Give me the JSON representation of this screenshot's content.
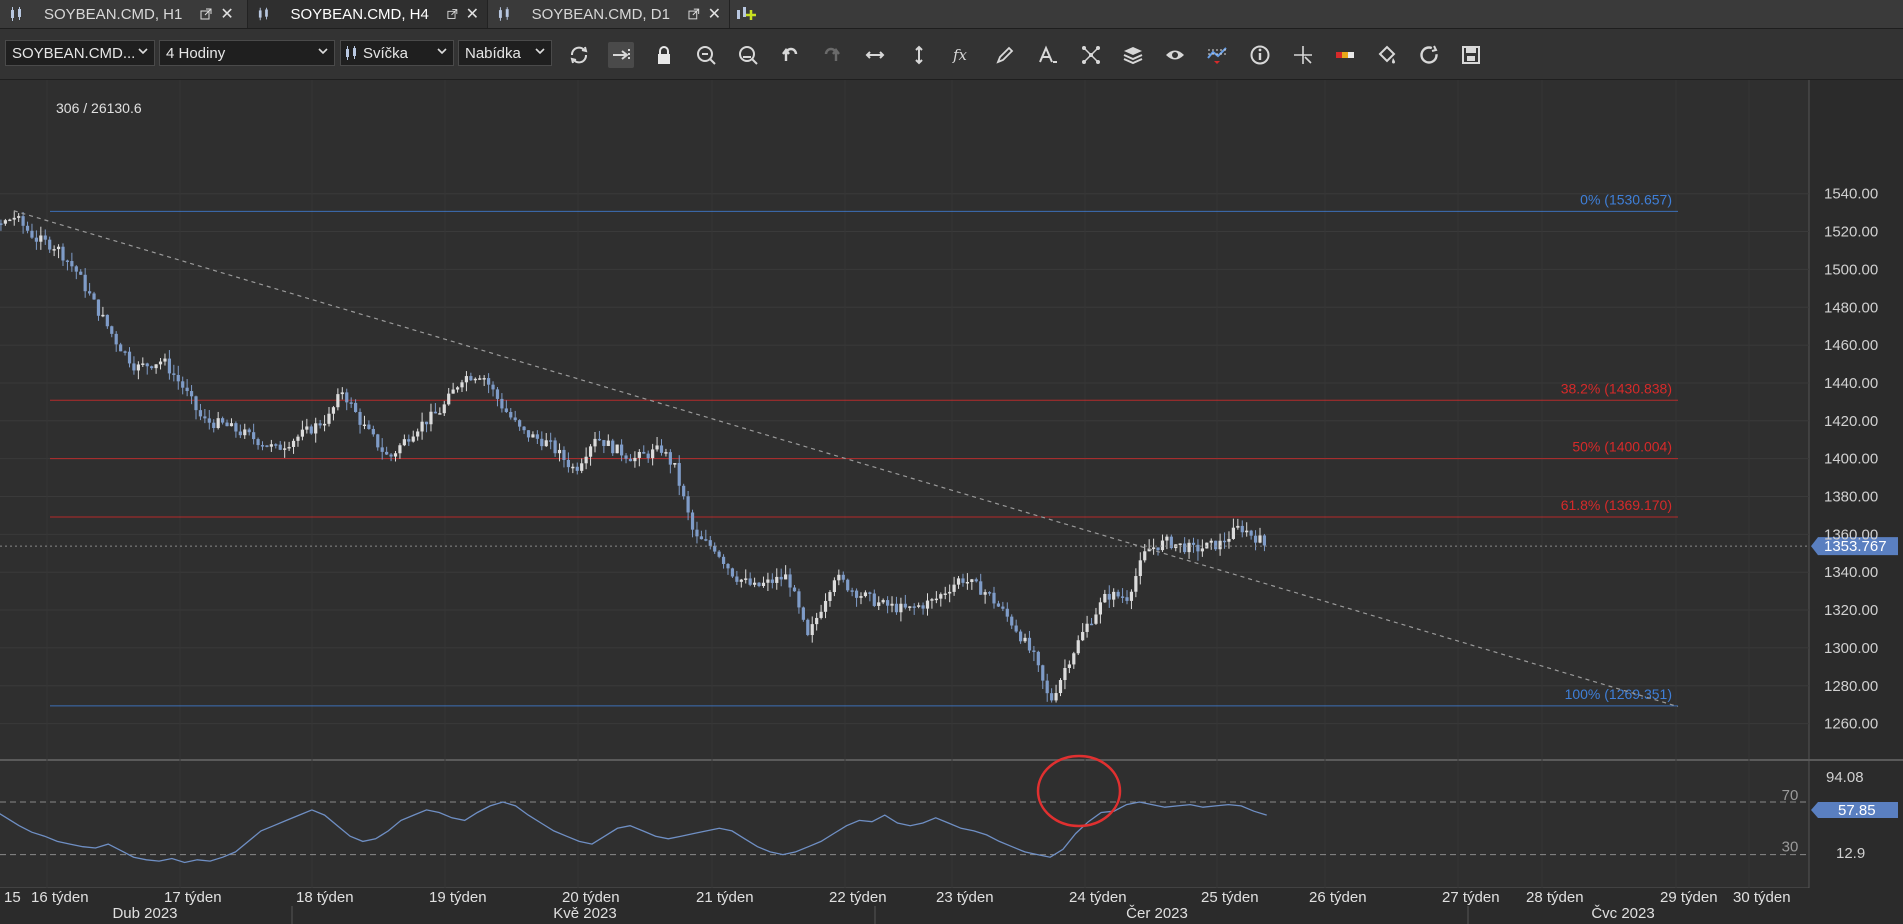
{
  "tabs": [
    {
      "label": "SOYBEAN.CMD, H1",
      "active": false
    },
    {
      "label": "SOYBEAN.CMD, H4",
      "active": true
    },
    {
      "label": "SOYBEAN.CMD, D1",
      "active": false
    }
  ],
  "toolbar": {
    "symbol": "SOYBEAN.CMD...",
    "timeframe": "4 Hodiny",
    "chart_type": "Svíčka",
    "price_type": "Nabídka"
  },
  "icons": [
    "refresh-icon",
    "autoscroll-icon",
    "lock-icon",
    "zoom-in-icon",
    "zoom-out-icon",
    "undo-icon",
    "redo-icon",
    "fit-horizontal-icon",
    "fit-vertical-icon",
    "indicators-icon",
    "draw-pencil-icon",
    "text-tool-icon",
    "objects-icon",
    "layers-icon",
    "visibility-icon",
    "compare-icon",
    "info-icon",
    "crosshair-icon",
    "color-scheme-icon",
    "paint-bucket-icon",
    "reload-icon",
    "save-icon"
  ],
  "chart_data": {
    "type": "candlestick",
    "symbol": "SOYBEAN.CMD",
    "timeframe": "H4",
    "crosshair_label": "306 / 26130.6",
    "price_axis": {
      "ticks": [
        1540,
        1520,
        1500,
        1480,
        1460,
        1440,
        1420,
        1400,
        1380,
        1360,
        1340,
        1320,
        1300,
        1280,
        1260
      ],
      "tick_labels": [
        "1540.00",
        "1520.00",
        "1500.00",
        "1480.00",
        "1460.00",
        "1440.00",
        "1420.00",
        "1400.00",
        "1380.00",
        "1360.00",
        "1340.00",
        "1320.00",
        "1300.00",
        "1280.00",
        "1260.00"
      ],
      "range": [
        1252,
        1548
      ]
    },
    "current_price": 1353.767,
    "current_price_label": "1353.767",
    "fibonacci": [
      {
        "label": "0% (1530.657)",
        "price": 1530.657,
        "color": "#3f7fd8"
      },
      {
        "label": "38.2% (1430.838)",
        "price": 1430.838,
        "color": "#d62a2a"
      },
      {
        "label": "50% (1400.004)",
        "price": 1400.004,
        "color": "#d62a2a"
      },
      {
        "label": "61.8% (1369.170)",
        "price": 1369.17,
        "color": "#d62a2a"
      },
      {
        "label": "100% (1269.351)",
        "price": 1269.351,
        "color": "#3f7fd8"
      }
    ],
    "trendline": {
      "start": {
        "week": "16 týden",
        "price": 1531
      },
      "end": {
        "week": "29 týden",
        "price": 1269
      }
    },
    "close_path": [
      {
        "week": 15.0,
        "price": 1500
      },
      {
        "week": 15.2,
        "price": 1497
      },
      {
        "week": 15.35,
        "price": 1505
      },
      {
        "week": 15.5,
        "price": 1522
      },
      {
        "week": 15.63,
        "price": 1528
      },
      {
        "week": 15.8,
        "price": 1516
      },
      {
        "week": 15.95,
        "price": 1512
      },
      {
        "week": 16.1,
        "price": 1499
      },
      {
        "week": 16.25,
        "price": 1480
      },
      {
        "week": 16.4,
        "price": 1462
      },
      {
        "week": 16.55,
        "price": 1448
      },
      {
        "week": 16.75,
        "price": 1452
      },
      {
        "week": 16.9,
        "price": 1438
      },
      {
        "week": 17.05,
        "price": 1420
      },
      {
        "week": 17.2,
        "price": 1418
      },
      {
        "week": 17.4,
        "price": 1412
      },
      {
        "week": 17.6,
        "price": 1405
      },
      {
        "week": 17.85,
        "price": 1415
      },
      {
        "week": 18.0,
        "price": 1422
      },
      {
        "week": 18.1,
        "price": 1436
      },
      {
        "week": 18.25,
        "price": 1418
      },
      {
        "week": 18.45,
        "price": 1400
      },
      {
        "week": 18.65,
        "price": 1416
      },
      {
        "week": 18.85,
        "price": 1426
      },
      {
        "week": 19.0,
        "price": 1443
      },
      {
        "week": 19.15,
        "price": 1445
      },
      {
        "week": 19.3,
        "price": 1428
      },
      {
        "week": 19.45,
        "price": 1414
      },
      {
        "week": 19.65,
        "price": 1408
      },
      {
        "week": 19.85,
        "price": 1394
      },
      {
        "week": 20.0,
        "price": 1412
      },
      {
        "week": 20.15,
        "price": 1405
      },
      {
        "week": 20.3,
        "price": 1400
      },
      {
        "week": 20.5,
        "price": 1405
      },
      {
        "week": 20.6,
        "price": 1395
      },
      {
        "week": 20.75,
        "price": 1358
      },
      {
        "week": 20.9,
        "price": 1353
      },
      {
        "week": 21.05,
        "price": 1338
      },
      {
        "week": 21.2,
        "price": 1332
      },
      {
        "week": 21.45,
        "price": 1338
      },
      {
        "week": 21.6,
        "price": 1305
      },
      {
        "week": 21.8,
        "price": 1338
      },
      {
        "week": 21.95,
        "price": 1330
      },
      {
        "week": 22.15,
        "price": 1323
      },
      {
        "week": 22.35,
        "price": 1320
      },
      {
        "week": 22.55,
        "price": 1325
      },
      {
        "week": 22.75,
        "price": 1337
      },
      {
        "week": 22.95,
        "price": 1329
      },
      {
        "week": 23.15,
        "price": 1312
      },
      {
        "week": 23.3,
        "price": 1295
      },
      {
        "week": 23.42,
        "price": 1271
      },
      {
        "week": 23.55,
        "price": 1292
      },
      {
        "week": 23.7,
        "price": 1312
      },
      {
        "week": 23.85,
        "price": 1328
      },
      {
        "week": 24.0,
        "price": 1327
      },
      {
        "week": 24.15,
        "price": 1352
      },
      {
        "week": 24.3,
        "price": 1356
      },
      {
        "week": 24.5,
        "price": 1352
      },
      {
        "week": 24.7,
        "price": 1355
      },
      {
        "week": 24.85,
        "price": 1364
      },
      {
        "week": 25.0,
        "price": 1357
      },
      {
        "week": 25.05,
        "price": 1353
      }
    ],
    "time_axis": {
      "weeks": [
        "15",
        "16 týden",
        "17 týden",
        "18 týden",
        "19 týden",
        "20 týden",
        "21 týden",
        "22 týden",
        "23 týden",
        "24 týden",
        "25 týden",
        "26 týden",
        "27 týden",
        "28 týden",
        "29 týden",
        "30 týden"
      ],
      "months": [
        "Dub 2023",
        "Kvě 2023",
        "Čer 2023",
        "Čvc 2023"
      ]
    },
    "rsi": {
      "levels": [
        70,
        30
      ],
      "axis_labels": [
        "94.08",
        "12.9"
      ],
      "current_label": "57.85",
      "values": [
        55,
        62,
        60,
        66,
        71,
        64,
        58,
        52,
        47,
        44,
        40,
        38,
        36,
        35,
        38,
        33,
        28,
        26,
        25,
        27,
        24,
        26,
        25,
        28,
        32,
        40,
        48,
        52,
        56,
        60,
        64,
        60,
        52,
        44,
        40,
        42,
        48,
        56,
        60,
        64,
        62,
        58,
        56,
        62,
        67,
        70,
        67,
        60,
        54,
        48,
        44,
        40,
        38,
        44,
        50,
        52,
        48,
        44,
        42,
        44,
        46,
        48,
        50,
        48,
        42,
        36,
        32,
        30,
        32,
        36,
        40,
        46,
        52,
        56,
        55,
        60,
        54,
        52,
        54,
        58,
        54,
        50,
        48,
        45,
        40,
        36,
        32,
        30,
        28,
        34,
        46,
        55,
        62,
        63,
        68,
        70,
        68,
        66,
        67,
        68,
        66,
        67,
        68,
        67,
        63,
        60
      ]
    }
  }
}
